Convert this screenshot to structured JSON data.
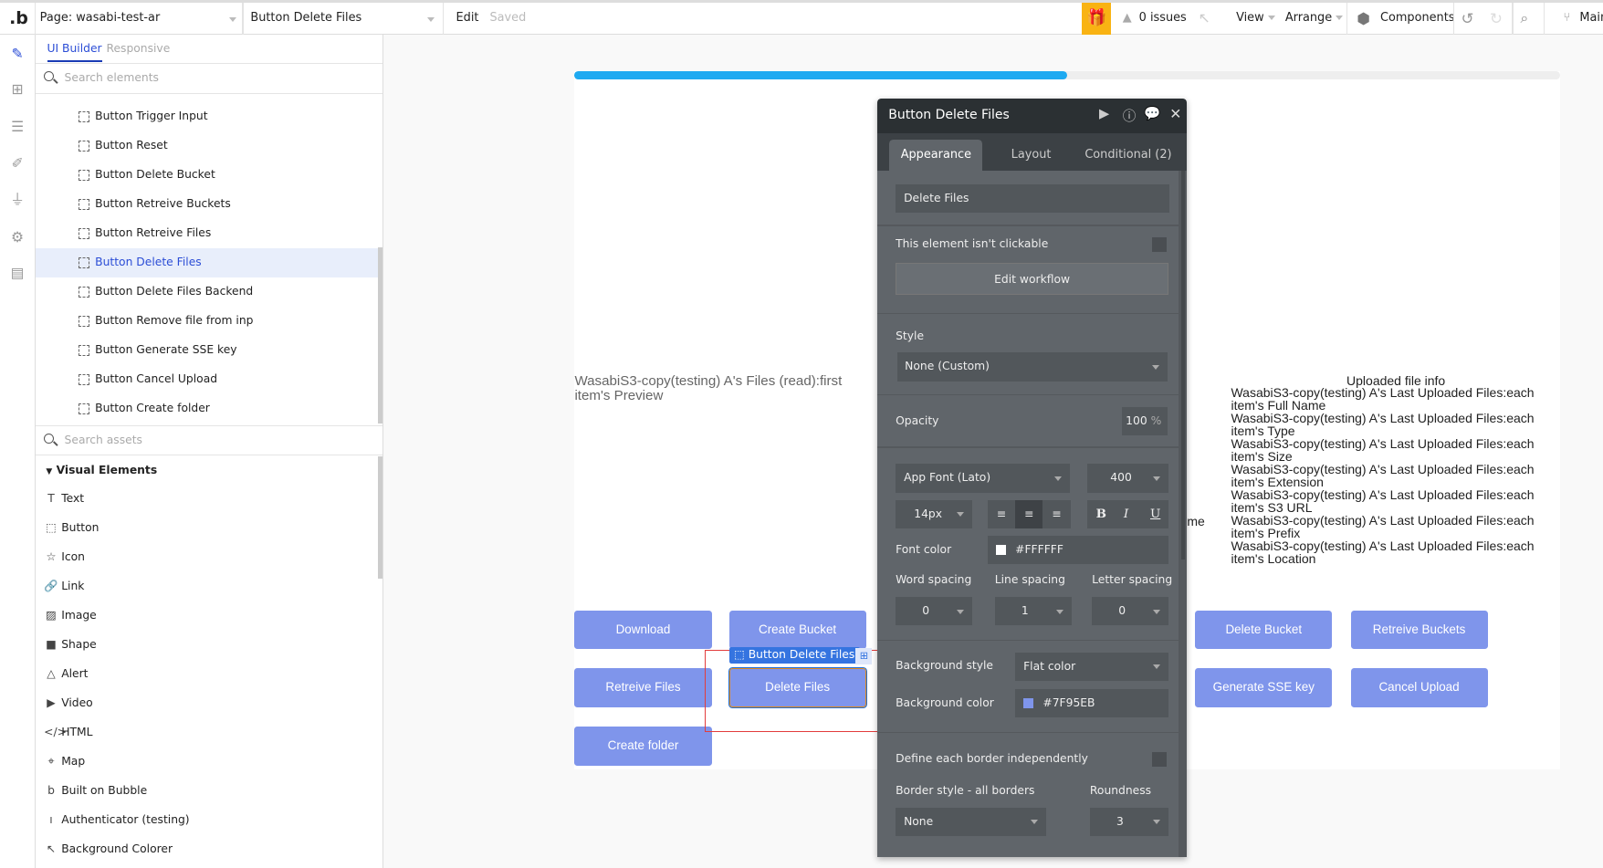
{
  "topbar": {
    "logo": ".b",
    "page_select": "Page: wasabi-test-ar",
    "element_select": "Button Delete Files",
    "edit": "Edit",
    "saved": "Saved",
    "issues": "0 issues",
    "view": "View",
    "arrange": "Arrange",
    "components": "Components",
    "branch": "Main"
  },
  "panel": {
    "tabs": [
      "UI Builder",
      "Responsive"
    ],
    "search_elements_placeholder": "Search elements",
    "tree": [
      "Button Trigger Input",
      "Button Reset",
      "Button Delete Bucket",
      "Button Retreive Buckets",
      "Button Retreive Files",
      "Button Delete Files",
      "Button Delete Files Backend",
      "Button Remove file from inp",
      "Button Generate SSE key",
      "Button Cancel Upload",
      "Button Create folder"
    ],
    "selected_index": 5,
    "search_assets_placeholder": "Search assets",
    "visual_elements_header": "Visual Elements",
    "visual_elements": [
      {
        "icon": "T",
        "label": "Text"
      },
      {
        "icon": "⬚",
        "label": "Button"
      },
      {
        "icon": "☆",
        "label": "Icon"
      },
      {
        "icon": "🔗",
        "label": "Link"
      },
      {
        "icon": "▨",
        "label": "Image"
      },
      {
        "icon": "■",
        "label": "Shape"
      },
      {
        "icon": "△",
        "label": "Alert"
      },
      {
        "icon": "▶",
        "label": "Video"
      },
      {
        "icon": "</>",
        "label": "HTML"
      },
      {
        "icon": "⌖",
        "label": "Map"
      },
      {
        "icon": "b",
        "label": "Built on Bubble"
      },
      {
        "icon": "ı",
        "label": "Authenticator (testing)"
      },
      {
        "icon": "↖",
        "label": "Background Colorer"
      }
    ]
  },
  "canvas": {
    "progress_percent": 50,
    "preview_text": "WasabiS3-copy(testing) A's Files (read):first item's Preview",
    "uploaded_title": "Uploaded file info",
    "uploaded_lines": [
      "WasabiS3-copy(testing) A's Last Uploaded Files:each item's Full Name",
      "WasabiS3-copy(testing) A's Last Uploaded Files:each item's Type",
      "WasabiS3-copy(testing) A's Last Uploaded Files:each item's Size",
      "WasabiS3-copy(testing) A's Last Uploaded Files:each item's Extension",
      "WasabiS3-copy(testing) A's Last Uploaded Files:each item's S3 URL",
      "WasabiS3-copy(testing) A's Last Uploaded Files:each item's Prefix",
      "WasabiS3-copy(testing) A's Last Uploaded Files:each item's Location"
    ],
    "hidden_fragment": "me",
    "buttons": {
      "download": "Download",
      "create_bucket": "Create Bucket",
      "delete_bucket": "Delete Bucket",
      "retreive_buckets": "Retreive Buckets",
      "retreive_files": "Retreive Files",
      "delete_files": "Delete Files",
      "generate_sse": "Generate SSE key",
      "cancel_upload": "Cancel Upload",
      "create_folder": "Create folder"
    },
    "selection_label": "Button Delete Files",
    "button_color": "#7F95EB"
  },
  "props": {
    "title": "Button Delete Files",
    "tabs": [
      "Appearance",
      "Layout",
      "Conditional (2)"
    ],
    "text_value": "Delete Files",
    "not_clickable": "This element isn't clickable",
    "edit_workflow": "Edit workflow",
    "style_label": "Style",
    "style_value": "None (Custom)",
    "opacity_label": "Opacity",
    "opacity_value": "100",
    "opacity_unit": "%",
    "font": "App Font (Lato)",
    "weight": "400",
    "size": "14px",
    "bold": "B",
    "italic": "I",
    "underline": "U",
    "font_color_label": "Font color",
    "font_color": "#FFFFFF",
    "word_spacing_label": "Word spacing",
    "word_spacing": "0",
    "line_spacing_label": "Line spacing",
    "line_spacing": "1",
    "letter_spacing_label": "Letter spacing",
    "letter_spacing": "0",
    "bg_style_label": "Background style",
    "bg_style": "Flat color",
    "bg_color_label": "Background color",
    "bg_color": "#7F95EB",
    "border_indep_label": "Define each border independently",
    "border_style_label": "Border style - all borders",
    "border_style": "None",
    "roundness_label": "Roundness",
    "roundness": "3"
  }
}
